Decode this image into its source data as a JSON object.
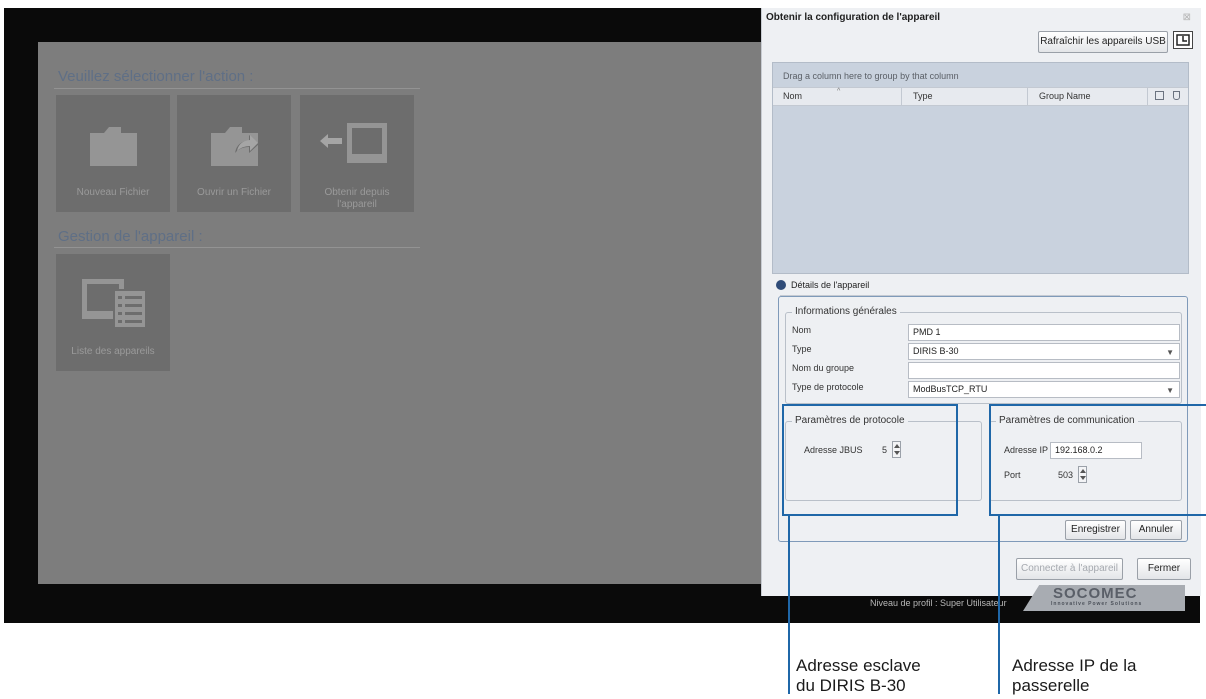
{
  "left_panel": {
    "section1_title": "Veuillez sélectionner l'action :",
    "tiles": [
      {
        "label": "Nouveau Fichier",
        "icon": "folder-icon"
      },
      {
        "label": "Ouvrir un Fichier",
        "icon": "folder-open-arrow-icon"
      },
      {
        "label": "Obtenir depuis l'appareil",
        "icon": "monitor-import-icon"
      }
    ],
    "section2_title": "Gestion de l'appareil :",
    "device_tile": {
      "label": "Liste des appareils",
      "icon": "device-list-icon"
    }
  },
  "dialog": {
    "title": "Obtenir la configuration de l'appareil",
    "refresh_button": "Rafraîchir les appareils USB",
    "grid": {
      "group_hint": "Drag a column here to group by that column",
      "columns": [
        "Nom",
        "Type",
        "Group Name"
      ]
    },
    "details_header": "Détails de l'appareil",
    "general": {
      "legend": "Informations générales",
      "name_label": "Nom",
      "name_value": "PMD 1",
      "type_label": "Type",
      "type_value": "DIRIS B-30",
      "group_label": "Nom du groupe",
      "group_value": "",
      "protocol_label": "Type de protocole",
      "protocol_value": "ModBusTCP_RTU"
    },
    "protocol": {
      "legend": "Paramètres de protocole",
      "jbus_label": "Adresse JBUS",
      "jbus_value": "5"
    },
    "communication": {
      "legend": "Paramètres de communication",
      "ip_label": "Adresse IP",
      "ip_value": "192.168.0.2",
      "port_label": "Port",
      "port_value": "503"
    },
    "save_button": "Enregistrer",
    "cancel_button": "Annuler",
    "connect_button": "Connecter à l'appareil",
    "close_button": "Fermer"
  },
  "status_bar": {
    "profile_text": "Niveau de profil : Super Utilisateur",
    "logo_text": "SOCOMEC",
    "logo_tagline": "Innovative Power Solutions"
  },
  "annotations": {
    "slave_address": [
      "Adresse esclave",
      "du DIRIS B-30"
    ],
    "gateway_ip": [
      "Adresse IP de la",
      "passerelle"
    ]
  },
  "colors": {
    "callout_blue": "#1f67a8",
    "title_blue": "#5f6f86",
    "tile_gray": "#6d6d6d"
  }
}
